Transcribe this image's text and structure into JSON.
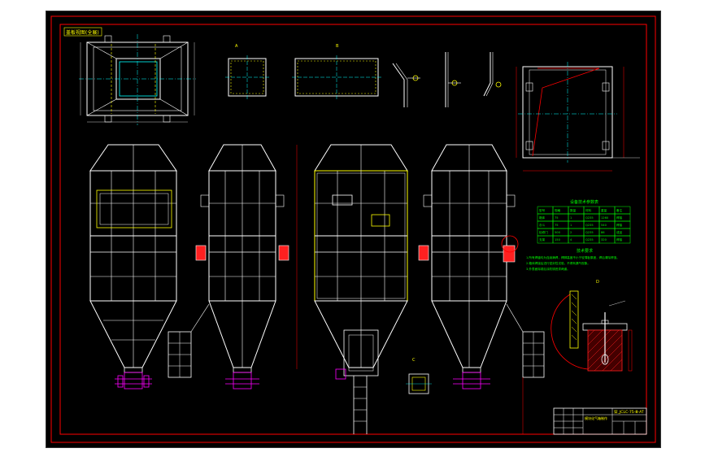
{
  "drawing": {
    "title_block_code": "穿_JCLC-75-Ⅲ-AT",
    "title_block_name": "模块化气箱制作",
    "view_label_top_left": "盖板视图(全展)",
    "detail_label_1": "A",
    "detail_label_2": "B",
    "detail_label_3": "C",
    "detail_label_4": "D",
    "table_title": "设备技术参数表",
    "notes_title": "技术要求",
    "note_lines": [
      "1.所有焊缝均为连续满焊，焊脚高度不小于较薄板厚度，焊后清除焊渣。",
      "2.箱体焊接后进行密封性试验，不得有漏气现象。",
      "3.外表面除锈后涂防锈底漆两道。"
    ],
    "table_rows": [
      [
        "型号",
        "规格",
        "数量",
        "材料",
        "重量",
        "备注"
      ],
      [
        "箱体",
        "75",
        "1",
        "Q235",
        "1260",
        "焊接"
      ],
      [
        "灰斗",
        "75",
        "1",
        "Q235",
        "540",
        "焊接"
      ],
      [
        "检修门",
        "500",
        "2",
        "Q235",
        "86",
        "成品"
      ],
      [
        "支架",
        "150",
        "4",
        "Q235",
        "320",
        "焊接"
      ]
    ]
  },
  "colors": {
    "page_bg": "#ffffff",
    "drawing_bg": "#000000",
    "frame_red": "#ff0000",
    "line_white": "#ffffff",
    "line_yellow": "#ffff00",
    "line_cyan": "#00ffff",
    "line_magenta": "#ff00ff",
    "line_green": "#00ff00",
    "hatch_red": "#ff2020"
  }
}
